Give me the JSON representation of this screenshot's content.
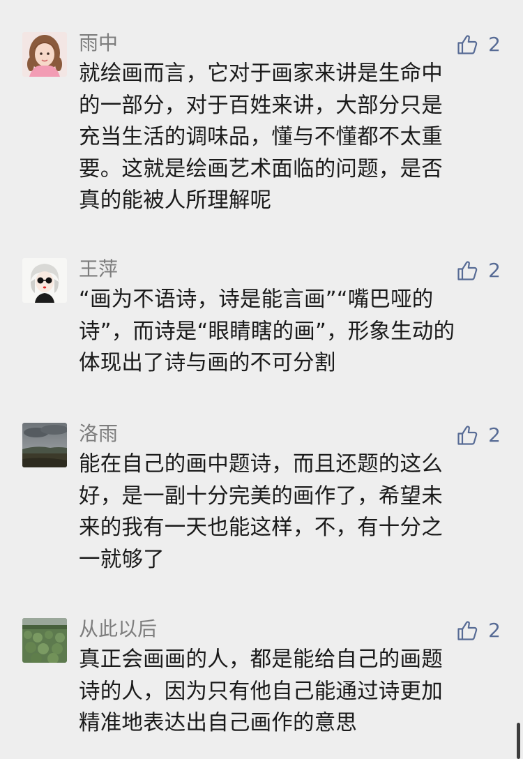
{
  "colors": {
    "background": "#eeeeee",
    "username": "#7d7d7d",
    "text": "#1a1a1a",
    "like_accent": "#576b95"
  },
  "comments": [
    {
      "username": "雨中",
      "avatar": "avatar-girl-portrait",
      "likes": "2",
      "text": "就绘画而言，它对于画家来讲是生命中\n的一部分，对于百姓来讲，大部分只是\n充当生活的调味品，懂与不懂都不太重\n要。这就是绘画艺术面临的问题，是否\n真的能被人所理解呢"
    },
    {
      "username": "王萍",
      "avatar": "avatar-cartoon-sunglasses",
      "likes": "2",
      "text": "“画为不语诗，诗是能言画”“嘴巴哑的\n诗”，而诗是“眼睛瞎的画”，形象生动的\n体现出了诗与画的不可分割"
    },
    {
      "username": "洛雨",
      "avatar": "avatar-landscape-cloudy",
      "likes": "2",
      "text": "能在自己的画中题诗，而且还题的这么\n好，是一副十分完美的画作了，希望未\n来的我有一天也能这样，不，有十分之\n一就够了"
    },
    {
      "username": "从此以后",
      "avatar": "avatar-green-field",
      "likes": "2",
      "text": "真正会画画的人，都是能给自己的画题\n诗的人，因为只有他自己能通过诗更加\n精准地表达出自己画作的意思"
    }
  ]
}
